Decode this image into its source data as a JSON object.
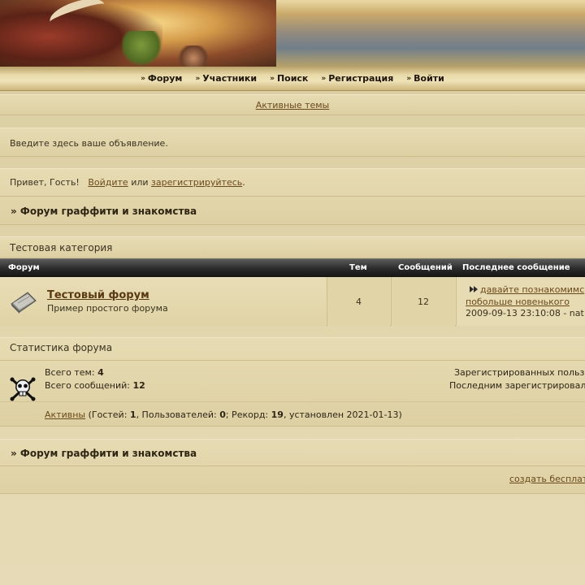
{
  "nav": {
    "items": [
      {
        "label": "Форум"
      },
      {
        "label": "Участники"
      },
      {
        "label": "Поиск"
      },
      {
        "label": "Регистрация"
      },
      {
        "label": "Войти"
      }
    ]
  },
  "active_topics_link": "Активные темы",
  "announcement": "Введите здесь ваше объявление.",
  "greeting": {
    "prefix": "Привет, Гость!",
    "login_link": "Войдите",
    "or_text": "или",
    "register_link": "зарегистрируйтесь",
    "suffix": "."
  },
  "breadcrumb": "» Форум граффити и знакомства",
  "category": {
    "name": "Тестовая категория",
    "columns": {
      "forum": "Форум",
      "topics": "Тем",
      "posts": "Сообщений",
      "last_post": "Последнее сообщение"
    },
    "forums": [
      {
        "title": "Тестовый форум",
        "description": "Пример простого форума",
        "topics": "4",
        "posts": "12",
        "last_post_title": "давайте познакомимся и побольше новенького",
        "last_post_line1": "давайте познакомимс",
        "last_post_line2": "побольше новенького",
        "last_post_meta": "2009-09-13 23:10:08 - nat"
      }
    ]
  },
  "stats": {
    "title": "Статистика форума",
    "topics_label": "Всего тем:",
    "topics_value": "4",
    "posts_label": "Всего сообщений:",
    "posts_value": "12",
    "registered_text": "Зарегистрированных польз",
    "last_registered_text": "Последним зарегистрировал",
    "active_link": "Активны",
    "online_open": "(Гостей:",
    "guests": "1",
    "users_label": ", Пользователей:",
    "users": "0",
    "record_label": "; Рекорд:",
    "record": "19",
    "record_set": ", установлен 2021-01-13)"
  },
  "footer": {
    "breadcrumb": "» Форум граффити и знакомства",
    "create_link": "создать бесплат"
  }
}
